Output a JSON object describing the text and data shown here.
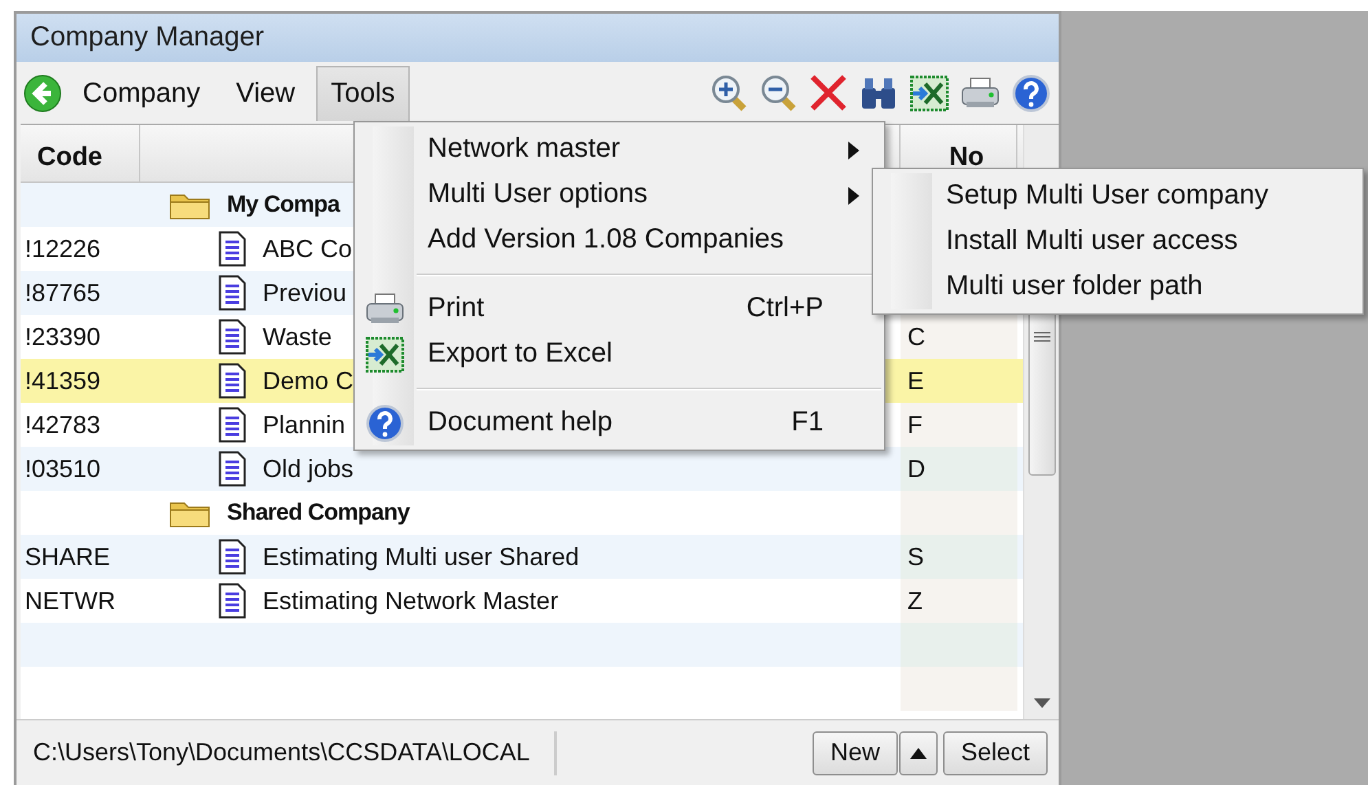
{
  "window": {
    "title": "Company Manager"
  },
  "menu_bar": [
    {
      "label": "Company",
      "selected": false
    },
    {
      "label": "View",
      "selected": false
    },
    {
      "label": "Tools",
      "selected": true
    }
  ],
  "table": {
    "columns": {
      "code": "Code",
      "number": "No"
    },
    "rows": [
      {
        "kind": "group",
        "label": "My Compa"
      },
      {
        "kind": "company",
        "code": "!12226",
        "name": "ABC Co",
        "selected": false
      },
      {
        "kind": "company",
        "code": "!87765",
        "name": "Previou",
        "selected": false
      },
      {
        "kind": "company",
        "code": "!23390",
        "name": "Waste",
        "number": "C",
        "selected": false
      },
      {
        "kind": "company",
        "code": "!41359",
        "name": "Demo C",
        "number": "E",
        "selected": true
      },
      {
        "kind": "company",
        "code": "!42783",
        "name": "Plannin",
        "number": "F",
        "selected": false
      },
      {
        "kind": "company",
        "code": "!03510",
        "name": "Old jobs",
        "number": "D",
        "selected": false
      },
      {
        "kind": "group",
        "label": "Shared Company"
      },
      {
        "kind": "company",
        "code": "SHARE",
        "name": "Estimating Multi user Shared",
        "number": "S",
        "selected": false
      },
      {
        "kind": "company",
        "code": "NETWR",
        "name": "Estimating Network Master",
        "number": "Z",
        "selected": false
      }
    ]
  },
  "tools_menu": [
    {
      "kind": "submenu",
      "label": "Network master"
    },
    {
      "kind": "submenu",
      "label": "Multi User options"
    },
    {
      "kind": "plain",
      "label": "Add Version 1.08 Companies"
    },
    {
      "kind": "separator"
    },
    {
      "kind": "print",
      "label": "Print",
      "shortcut": "Ctrl+P"
    },
    {
      "kind": "excel",
      "label": "Export to Excel"
    },
    {
      "kind": "separator"
    },
    {
      "kind": "help",
      "label": "Document help",
      "shortcut": "F1"
    }
  ],
  "multi_user_submenu": [
    {
      "label": "Setup Multi User company"
    },
    {
      "label": "Install Multi user access"
    },
    {
      "label": "Multi user folder path"
    }
  ],
  "status_bar": {
    "path": "C:\\Users\\Tony\\Documents\\CCSDATA\\LOCAL",
    "buttons": [
      {
        "kind": "text",
        "label": "New"
      },
      {
        "kind": "arrow"
      },
      {
        "kind": "text",
        "label": "Select"
      }
    ]
  }
}
